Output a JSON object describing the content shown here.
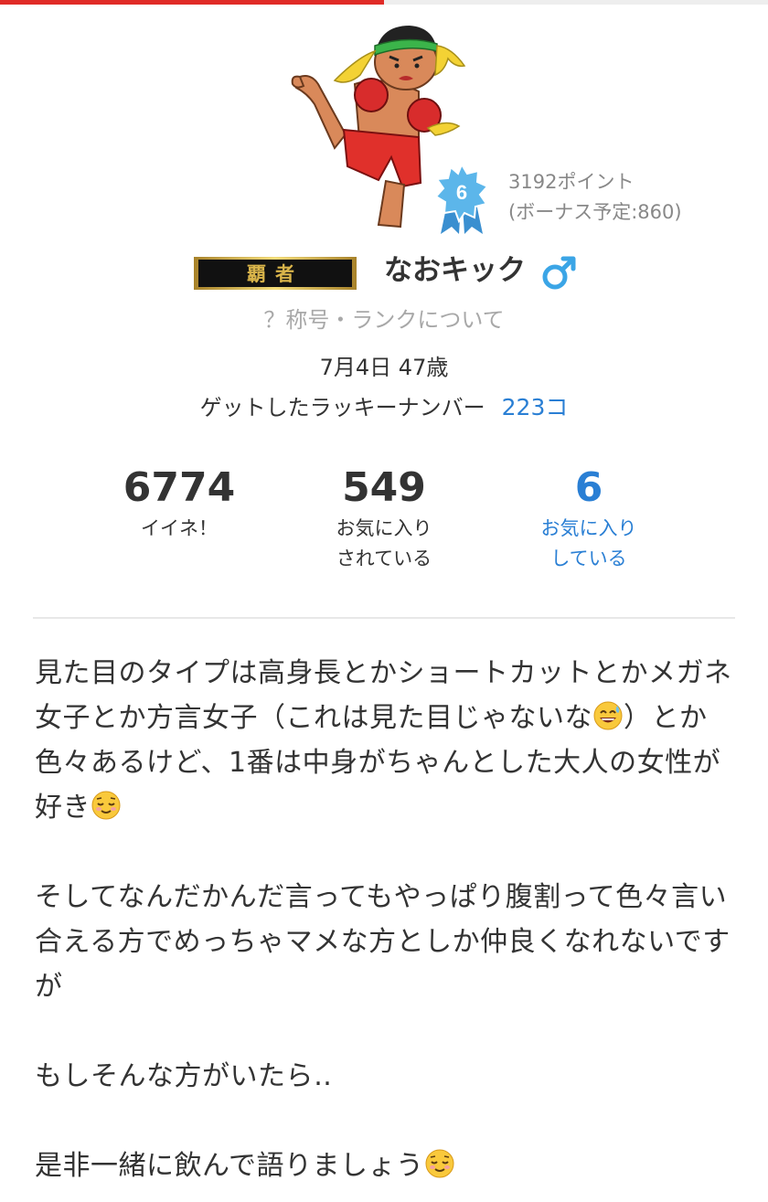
{
  "progress": {
    "fraction": 0.5,
    "fill_color": "#e02b27"
  },
  "profile": {
    "avatar_icon": "kickboxer-illustration",
    "rank": {
      "level": "6",
      "icon": "ribbon-badge-icon",
      "color": "#4aa8e0"
    },
    "points": {
      "line1": "3192ポイント",
      "line2": "(ボーナス予定:860)"
    },
    "title_plate_text": "覇者",
    "nickname": "なおキック",
    "gender_icon": "male-symbol-icon",
    "gender_color": "#3ba5e6",
    "rank_info_link": "？称号・ランクについて",
    "birth_age": "7月4日 47歳",
    "lucky": {
      "label": "ゲットしたラッキーナンバー",
      "value": "223コ"
    }
  },
  "stats": [
    {
      "value": "6774",
      "label_line1": "イイネ！",
      "label_line2": ""
    },
    {
      "value": "549",
      "label_line1": "お気に入り",
      "label_line2": "されている"
    },
    {
      "value": "6",
      "label_line1": "お気に入り",
      "label_line2": "している"
    }
  ],
  "bio": {
    "p1_text": "見た目のタイプは高身長とかショートカットとかメガネ女子とか方言女子（これは見た目じゃないな",
    "p1_emoji": "sweat-smile-emoji",
    "p1_text2": "）とか色々あるけど、1番は中身がちゃんとした大人の女性が好き",
    "p1_emoji2": "relieved-face-emoji",
    "p2_text": "そしてなんだかんだ言ってもやっぱり腹割って色々言い合える方でめっちゃマメな方としか仲良くなれないですが",
    "p3_text": "もしそんな方がいたら‥",
    "p4_text": "是非一緒に飲んで語りましょう",
    "p4_emoji": "relieved-face-emoji"
  },
  "colors": {
    "link_blue": "#2a7fd4",
    "muted_gray": "#a8a8a8"
  }
}
